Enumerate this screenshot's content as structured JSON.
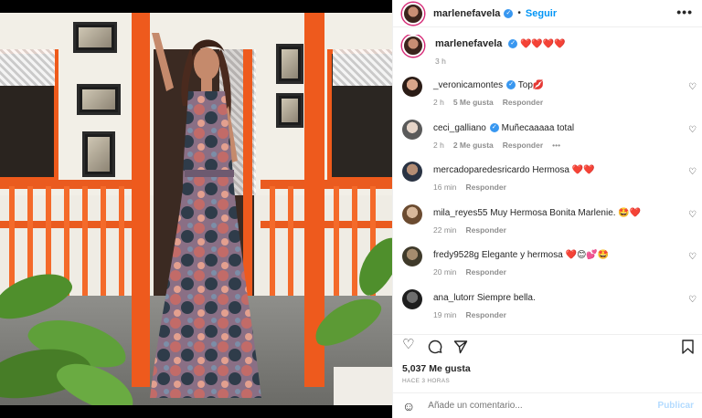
{
  "post": {
    "author": "marlenefavela",
    "dot": "•",
    "follow_label": "Seguir",
    "more_icon": "more-horizontal-icon",
    "caption_text": "❤️❤️❤️❤️",
    "caption_time": "3 h",
    "likes": "5,037 Me gusta",
    "posted_time": "HACE 3 HORAS"
  },
  "comments": [
    {
      "user": "_veronicamontes",
      "verified": true,
      "text": "Top💋",
      "time": "2 h",
      "likes": "5 Me gusta",
      "reply": "Responder"
    },
    {
      "user": "ceci_galliano",
      "verified": true,
      "text": "Muñecaaaaa total",
      "time": "2 h",
      "likes": "2 Me gusta",
      "reply": "Responder",
      "more": "•••"
    },
    {
      "user": "mercadoparedesricardo",
      "verified": false,
      "text": "Hermosa ❤️❤️",
      "time": "16 min",
      "likes": "",
      "reply": "Responder"
    },
    {
      "user": "mila_reyes55",
      "verified": false,
      "text": "Muy Hermosa Bonita Marlenie. 🤩❤️",
      "time": "22 min",
      "likes": "",
      "reply": "Responder"
    },
    {
      "user": "fredy9528g",
      "verified": false,
      "text": "Elegante y hermosa ❤️😊💕🤩",
      "time": "20 min",
      "likes": "",
      "reply": "Responder"
    },
    {
      "user": "ana_lutorr",
      "verified": false,
      "text": "Siempre bella.",
      "time": "19 min",
      "likes": "",
      "reply": "Responder"
    }
  ],
  "composer": {
    "placeholder": "Añade un comentario...",
    "publish_label": "Publicar"
  },
  "colors": {
    "accent": "#0095f6",
    "publish_disabled": "#b3dbff",
    "door_frame": "#ee5a1d"
  }
}
